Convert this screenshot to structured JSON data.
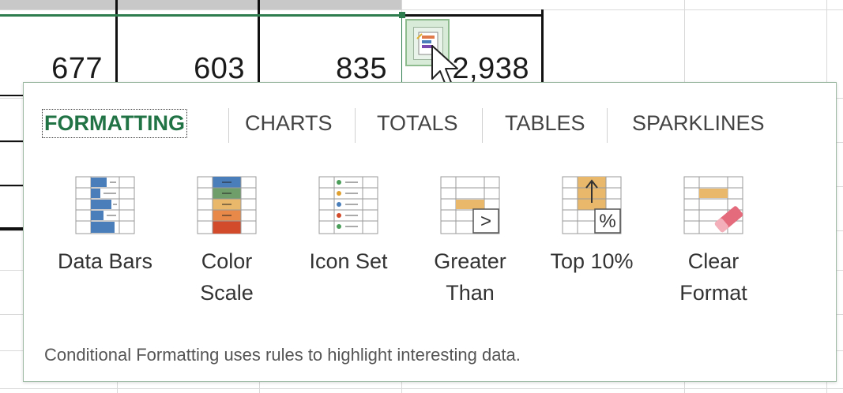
{
  "sheet": {
    "cells": [
      "677",
      "603",
      "835",
      "2,938"
    ]
  },
  "quick_analysis": {
    "tabs": [
      {
        "label": "FORMATTING",
        "active": true
      },
      {
        "label": "CHARTS",
        "active": false
      },
      {
        "label": "TOTALS",
        "active": false
      },
      {
        "label": "TABLES",
        "active": false
      },
      {
        "label": "SPARKLINES",
        "active": false
      }
    ],
    "tools": [
      {
        "label": "Data Bars",
        "icon": "data-bars-icon"
      },
      {
        "label": "Color Scale",
        "icon": "color-scale-icon"
      },
      {
        "label": "Icon Set",
        "icon": "icon-set-icon"
      },
      {
        "label": "Greater Than",
        "icon": "greater-than-icon",
        "badge": ">"
      },
      {
        "label": "Top 10%",
        "icon": "top-10-percent-icon",
        "badge": "%"
      },
      {
        "label": "Clear Format",
        "icon": "clear-format-icon"
      }
    ],
    "description": "Conditional Formatting uses rules to highlight interesting data."
  },
  "colors": {
    "accent": "#217346",
    "data_bar": "#4a7ebb",
    "highlight": "#e9b86a",
    "eraser": "#e46b7c"
  }
}
